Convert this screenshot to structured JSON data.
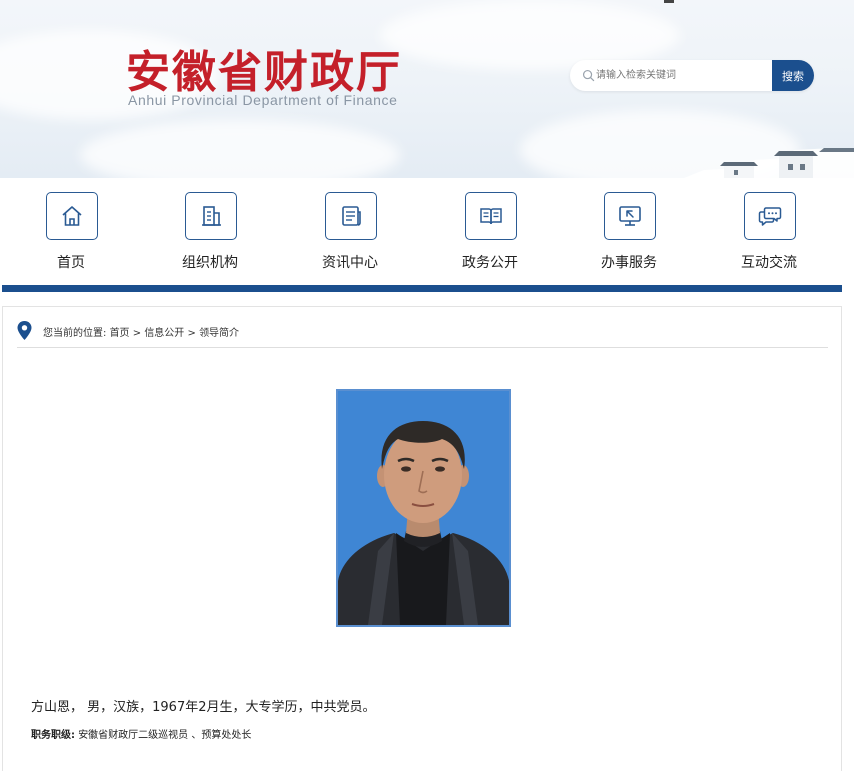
{
  "header": {
    "title_cn": "安徽省财政厅",
    "title_en": "Anhui Provincial Department of Finance"
  },
  "search": {
    "placeholder": "请输入检索关键词",
    "button_label": "搜索"
  },
  "nav": {
    "items": [
      {
        "label": "首页",
        "icon": "home-icon"
      },
      {
        "label": "组织机构",
        "icon": "building-icon"
      },
      {
        "label": "资讯中心",
        "icon": "newspaper-icon"
      },
      {
        "label": "政务公开",
        "icon": "open-book-icon"
      },
      {
        "label": "办事服务",
        "icon": "monitor-pointer-icon"
      },
      {
        "label": "互动交流",
        "icon": "chat-bubbles-icon"
      }
    ]
  },
  "breadcrumb": {
    "prefix": "您当前的位置:",
    "items": [
      "首页",
      "信息公开",
      "领导简介"
    ],
    "separator": " > "
  },
  "profile": {
    "photo_icon": "portrait-photo",
    "bio": "方山恩，  男，汉族，1967年2月生，大专学历，中共党员。",
    "position_label": "职务职级:",
    "position_value": "安徽省财政厅二级巡视员 、预算处处长"
  },
  "colors": {
    "brand_red": "#c4202a",
    "brand_blue": "#1b4f8e",
    "icon_border": "#2a5a93",
    "photo_bg": "#3f86d4"
  }
}
